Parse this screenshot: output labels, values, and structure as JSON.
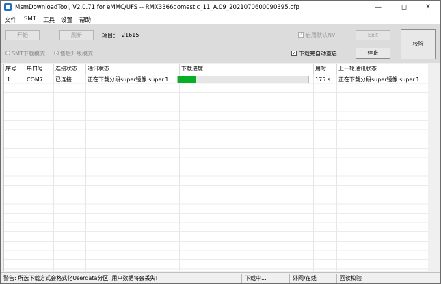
{
  "window": {
    "title": "MsmDownloadTool, V2.0.71 for eMMC/UFS -- RMX3366domestic_11_A.09_2021070600090395.ofp"
  },
  "menu": [
    "文件",
    "SMT",
    "工具",
    "设置",
    "帮助"
  ],
  "toolbar": {
    "start_label": "开始",
    "stop_refresh_label": "刷新",
    "project_label": "项目：",
    "project_value": "21615",
    "smt_mode_label": "SMT下载模式",
    "after_sale_mode_label": "售后升级模式",
    "enable_default_nv_label": "启用默认NV",
    "exit_label": "Exit",
    "auto_reboot_label": "下载完自动重启",
    "stop_label": "停止",
    "verify_label": "校验"
  },
  "table": {
    "columns": [
      "序号",
      "串口号",
      "连接状态",
      "通讯状态",
      "下载进度",
      "用时",
      "上一轮通讯状态"
    ],
    "rows": [
      {
        "index": "1",
        "port": "COM7",
        "connection": "已连接",
        "comm_status": "正在下载分段super镜像 super.1....",
        "progress": 0.14,
        "elapsed": "175 s",
        "last_status": "正在下载分段super镜像 super.1...."
      }
    ]
  },
  "statusbar": {
    "warning": "警告: 所选下载方式会格式化Userdata分区, 用户数据将会丢失!",
    "download_state": "下载中...",
    "network": "外网/在线",
    "verify": "回读校验"
  },
  "colors": {
    "progress_fill": "#06b025",
    "accent": "#1e6fd0"
  }
}
